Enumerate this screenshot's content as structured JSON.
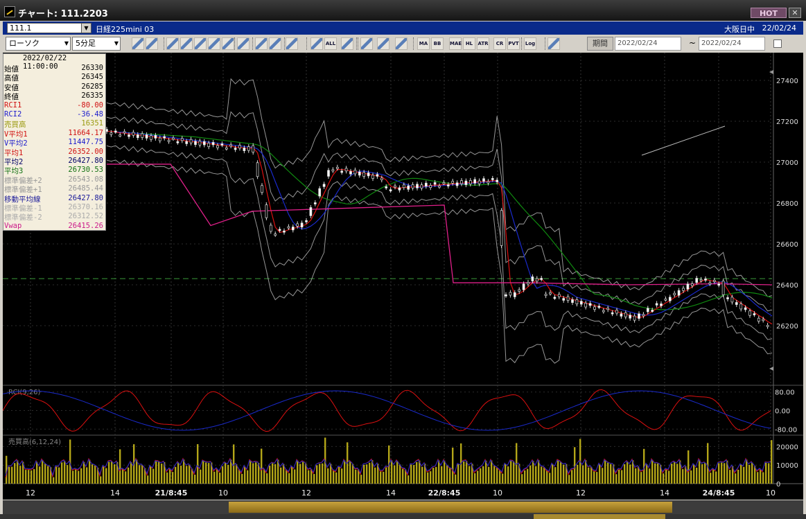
{
  "window": {
    "title": "チャート: 111.2203",
    "hot_label": "HOT",
    "close_label": "✕"
  },
  "symbol": {
    "code": "111.1",
    "name": "日経225mini 03",
    "session": "大阪日中",
    "date": "22/02/24"
  },
  "toolbar": {
    "chart_type": "ローソク",
    "timeframe": "5分足",
    "period_label": "期間",
    "date_from": "2022/02/24",
    "date_to": "2022/02/24",
    "tilde": "~",
    "buttons": [
      "zoom-icon",
      "crosshair-icon",
      "tool-icon",
      "search-icon",
      "bars-icon",
      "candle-icon",
      "pin-icon",
      "line-icon",
      "arrow-icon",
      "text-icon",
      "box-icon",
      "split-icon",
      "ALL",
      "palette-icon",
      "settings-icon",
      "color-icon",
      "volume-icon",
      "MA",
      "BB",
      "MAE",
      "HL",
      "ATR",
      "CR",
      "PVT",
      "Log",
      "export-icon"
    ]
  },
  "info_panel": {
    "datetime": "2022/02/22  11:00:00",
    "rows": [
      {
        "label": "始値",
        "value": "26330",
        "color": "#000000"
      },
      {
        "label": "高値",
        "value": "26345",
        "color": "#000000"
      },
      {
        "label": "安値",
        "value": "26285",
        "color": "#000000"
      },
      {
        "label": "終値",
        "value": "26335",
        "color": "#000000"
      },
      {
        "label": "RCI1",
        "value": "-80.00",
        "color": "#d01010"
      },
      {
        "label": "RCI2",
        "value": "-36.48",
        "color": "#1a1acc"
      },
      {
        "label": "売買高",
        "value": "16351",
        "color": "#9a9a10"
      },
      {
        "label": "V平均1",
        "value": "11664.17",
        "color": "#d01010"
      },
      {
        "label": "V平均2",
        "value": "11447.75",
        "color": "#1a1acc"
      },
      {
        "label": "平均1",
        "value": "26352.00",
        "color": "#d01010"
      },
      {
        "label": "平均2",
        "value": "26427.80",
        "color": "#000066"
      },
      {
        "label": "平均3",
        "value": "26730.53",
        "color": "#107010"
      },
      {
        "label": "標準偏差+2",
        "value": "26543.08",
        "color": "#999999"
      },
      {
        "label": "標準偏差+1",
        "value": "26485.44",
        "color": "#999999"
      },
      {
        "label": "移動平均線",
        "value": "26427.80",
        "color": "#1a1a99"
      },
      {
        "label": "標準偏差-1",
        "value": "26370.16",
        "color": "#aaaaaa"
      },
      {
        "label": "標準偏差-2",
        "value": "26312.52",
        "color": "#aaaaaa"
      },
      {
        "label": "Vwap",
        "value": "26415.26",
        "color": "#cc1a8a"
      }
    ]
  },
  "chart": {
    "price_ticks": [
      "27400",
      "27200",
      "27000",
      "26800",
      "26600",
      "26400",
      "26200"
    ],
    "rci_label": "RCI(9,26)",
    "rci_ticks": [
      "80.00",
      "0.00",
      "-80.00"
    ],
    "volume_label": "売買高(6,12,24)",
    "volume_ticks": [
      "20000",
      "10000",
      "0"
    ],
    "time_labels": [
      {
        "text": "12",
        "bold": false
      },
      {
        "text": "14",
        "bold": false
      },
      {
        "text": "21/8:45",
        "bold": true
      },
      {
        "text": "10",
        "bold": false
      },
      {
        "text": "12",
        "bold": false
      },
      {
        "text": "14",
        "bold": false
      },
      {
        "text": "22/8:45",
        "bold": true
      },
      {
        "text": "10",
        "bold": false
      },
      {
        "text": "12",
        "bold": false
      },
      {
        "text": "14",
        "bold": false
      },
      {
        "text": "24/8:45",
        "bold": true
      },
      {
        "text": "10",
        "bold": false
      }
    ]
  },
  "chart_data": {
    "type": "candlestick",
    "price_axis_range": [
      26100,
      27450
    ],
    "reference_level": 26430,
    "rci_axis_range": [
      -100,
      100
    ],
    "volume_axis_range": [
      0,
      25000
    ],
    "colors": {
      "up": "#ffffff",
      "down": "#000000",
      "ma1": "#dd1010",
      "ma2": "#1a2acc",
      "ma3": "#108a10",
      "bands": "#bdbdbd",
      "vwap": "#e0208a",
      "volume_bar": "#b3a618"
    }
  }
}
